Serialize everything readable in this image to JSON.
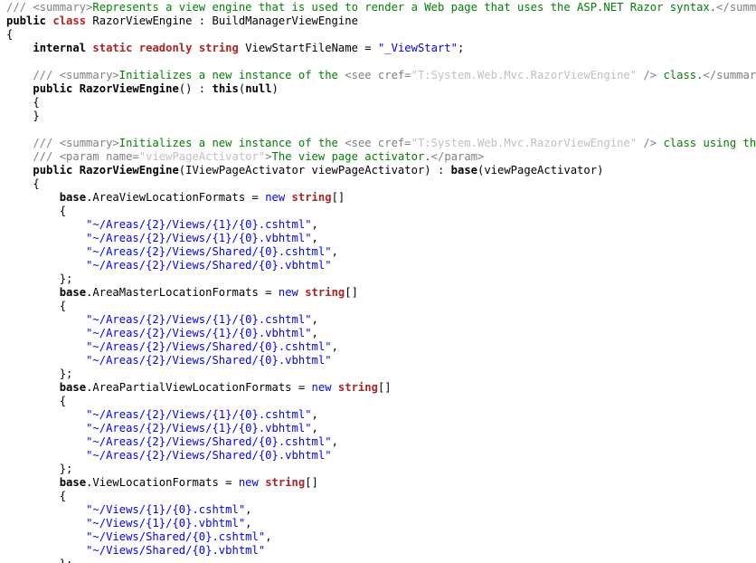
{
  "editor": {
    "lines": [
      [
        {
          "t": "/// ",
          "s": "dc"
        },
        {
          "t": "<summary>",
          "s": "dc"
        },
        {
          "t": "Represents a view engine that is used to render a Web page that uses the ASP.NET Razor syntax.",
          "s": "cm"
        },
        {
          "t": "</summary>",
          "s": "dc"
        }
      ],
      [
        {
          "t": "public ",
          "s": "kwb"
        },
        {
          "t": "class ",
          "s": "kwbr"
        },
        {
          "t": "RazorViewEngine : BuildManagerViewEngine",
          "s": "plain"
        }
      ],
      [
        {
          "t": "{",
          "s": "plain"
        }
      ],
      [
        {
          "t": "    ",
          "s": "plain"
        },
        {
          "t": "internal ",
          "s": "kwb"
        },
        {
          "t": "static readonly ",
          "s": "kwbr"
        },
        {
          "t": "string ",
          "s": "kwbr"
        },
        {
          "t": "ViewStartFileName = ",
          "s": "plain"
        },
        {
          "t": "\"_ViewStart\"",
          "s": "str"
        },
        {
          "t": ";",
          "s": "plain"
        }
      ],
      [
        {
          "t": "",
          "s": "plain"
        }
      ],
      [
        {
          "t": "    /// ",
          "s": "dc"
        },
        {
          "t": "<summary>",
          "s": "dc"
        },
        {
          "t": "Initializes a new instance of the ",
          "s": "cm"
        },
        {
          "t": "<see cref=",
          "s": "dc"
        },
        {
          "t": "\"T:System.Web.Mvc.RazorViewEngine\"",
          "s": "da"
        },
        {
          "t": " />",
          "s": "dc"
        },
        {
          "t": " class.",
          "s": "cm"
        },
        {
          "t": "</summary>",
          "s": "dc"
        }
      ],
      [
        {
          "t": "    ",
          "s": "plain"
        },
        {
          "t": "public ",
          "s": "kwb"
        },
        {
          "t": "RazorViewEngine",
          "s": "kwb"
        },
        {
          "t": "() : ",
          "s": "plain"
        },
        {
          "t": "this",
          "s": "kwb"
        },
        {
          "t": "(",
          "s": "plain"
        },
        {
          "t": "null",
          "s": "kwb"
        },
        {
          "t": ")",
          "s": "plain"
        }
      ],
      [
        {
          "t": "    {",
          "s": "plain"
        }
      ],
      [
        {
          "t": "    }",
          "s": "plain"
        }
      ],
      [
        {
          "t": "",
          "s": "plain"
        }
      ],
      [
        {
          "t": "    /// ",
          "s": "dc"
        },
        {
          "t": "<summary>",
          "s": "dc"
        },
        {
          "t": "Initializes a new instance of the ",
          "s": "cm"
        },
        {
          "t": "<see cref=",
          "s": "dc"
        },
        {
          "t": "\"T:System.Web.Mvc.RazorViewEngine\"",
          "s": "da"
        },
        {
          "t": " />",
          "s": "dc"
        },
        {
          "t": " class using the view",
          "s": "cm"
        }
      ],
      [
        {
          "t": "    /// ",
          "s": "dc"
        },
        {
          "t": "<param name=",
          "s": "dc"
        },
        {
          "t": "\"viewPageActivator\"",
          "s": "da"
        },
        {
          "t": ">",
          "s": "dc"
        },
        {
          "t": "The view page activator.",
          "s": "cm"
        },
        {
          "t": "</param>",
          "s": "dc"
        }
      ],
      [
        {
          "t": "    ",
          "s": "plain"
        },
        {
          "t": "public ",
          "s": "kwb"
        },
        {
          "t": "RazorViewEngine",
          "s": "kwb"
        },
        {
          "t": "(IViewPageActivator viewPageActivator) : ",
          "s": "plain"
        },
        {
          "t": "base",
          "s": "kwb"
        },
        {
          "t": "(viewPageActivator)",
          "s": "plain"
        }
      ],
      [
        {
          "t": "    {",
          "s": "plain"
        }
      ],
      [
        {
          "t": "        ",
          "s": "plain"
        },
        {
          "t": "base",
          "s": "kwb"
        },
        {
          "t": ".AreaViewLocationFormats = ",
          "s": "plain"
        },
        {
          "t": "new ",
          "s": "kw"
        },
        {
          "t": "string",
          "s": "kwbr"
        },
        {
          "t": "[]",
          "s": "plain"
        }
      ],
      [
        {
          "t": "        {",
          "s": "plain"
        }
      ],
      [
        {
          "t": "            ",
          "s": "plain"
        },
        {
          "t": "\"~/Areas/{2}/Views/{1}/{0}.cshtml\"",
          "s": "str"
        },
        {
          "t": ",",
          "s": "plain"
        }
      ],
      [
        {
          "t": "            ",
          "s": "plain"
        },
        {
          "t": "\"~/Areas/{2}/Views/{1}/{0}.vbhtml\"",
          "s": "str"
        },
        {
          "t": ",",
          "s": "plain"
        }
      ],
      [
        {
          "t": "            ",
          "s": "plain"
        },
        {
          "t": "\"~/Areas/{2}/Views/Shared/{0}.cshtml\"",
          "s": "str"
        },
        {
          "t": ",",
          "s": "plain"
        }
      ],
      [
        {
          "t": "            ",
          "s": "plain"
        },
        {
          "t": "\"~/Areas/{2}/Views/Shared/{0}.vbhtml\"",
          "s": "str"
        }
      ],
      [
        {
          "t": "        };",
          "s": "plain"
        }
      ],
      [
        {
          "t": "        ",
          "s": "plain"
        },
        {
          "t": "base",
          "s": "kwb"
        },
        {
          "t": ".AreaMasterLocationFormats = ",
          "s": "plain"
        },
        {
          "t": "new ",
          "s": "kw"
        },
        {
          "t": "string",
          "s": "kwbr"
        },
        {
          "t": "[]",
          "s": "plain"
        }
      ],
      [
        {
          "t": "        {",
          "s": "plain"
        }
      ],
      [
        {
          "t": "            ",
          "s": "plain"
        },
        {
          "t": "\"~/Areas/{2}/Views/{1}/{0}.cshtml\"",
          "s": "str"
        },
        {
          "t": ",",
          "s": "plain"
        }
      ],
      [
        {
          "t": "            ",
          "s": "plain"
        },
        {
          "t": "\"~/Areas/{2}/Views/{1}/{0}.vbhtml\"",
          "s": "str"
        },
        {
          "t": ",",
          "s": "plain"
        }
      ],
      [
        {
          "t": "            ",
          "s": "plain"
        },
        {
          "t": "\"~/Areas/{2}/Views/Shared/{0}.cshtml\"",
          "s": "str"
        },
        {
          "t": ",",
          "s": "plain"
        }
      ],
      [
        {
          "t": "            ",
          "s": "plain"
        },
        {
          "t": "\"~/Areas/{2}/Views/Shared/{0}.vbhtml\"",
          "s": "str"
        }
      ],
      [
        {
          "t": "        };",
          "s": "plain"
        }
      ],
      [
        {
          "t": "        ",
          "s": "plain"
        },
        {
          "t": "base",
          "s": "kwb"
        },
        {
          "t": ".AreaPartialViewLocationFormats = ",
          "s": "plain"
        },
        {
          "t": "new ",
          "s": "kw"
        },
        {
          "t": "string",
          "s": "kwbr"
        },
        {
          "t": "[]",
          "s": "plain"
        }
      ],
      [
        {
          "t": "        {",
          "s": "plain"
        }
      ],
      [
        {
          "t": "            ",
          "s": "plain"
        },
        {
          "t": "\"~/Areas/{2}/Views/{1}/{0}.cshtml\"",
          "s": "str"
        },
        {
          "t": ",",
          "s": "plain"
        }
      ],
      [
        {
          "t": "            ",
          "s": "plain"
        },
        {
          "t": "\"~/Areas/{2}/Views/{1}/{0}.vbhtml\"",
          "s": "str"
        },
        {
          "t": ",",
          "s": "plain"
        }
      ],
      [
        {
          "t": "            ",
          "s": "plain"
        },
        {
          "t": "\"~/Areas/{2}/Views/Shared/{0}.cshtml\"",
          "s": "str"
        },
        {
          "t": ",",
          "s": "plain"
        }
      ],
      [
        {
          "t": "            ",
          "s": "plain"
        },
        {
          "t": "\"~/Areas/{2}/Views/Shared/{0}.vbhtml\"",
          "s": "str"
        }
      ],
      [
        {
          "t": "        };",
          "s": "plain"
        }
      ],
      [
        {
          "t": "        ",
          "s": "plain"
        },
        {
          "t": "base",
          "s": "kwb"
        },
        {
          "t": ".ViewLocationFormats = ",
          "s": "plain"
        },
        {
          "t": "new ",
          "s": "kw"
        },
        {
          "t": "string",
          "s": "kwbr"
        },
        {
          "t": "[]",
          "s": "plain"
        }
      ],
      [
        {
          "t": "        {",
          "s": "plain"
        }
      ],
      [
        {
          "t": "            ",
          "s": "plain"
        },
        {
          "t": "\"~/Views/{1}/{0}.cshtml\"",
          "s": "str"
        },
        {
          "t": ",",
          "s": "plain"
        }
      ],
      [
        {
          "t": "            ",
          "s": "plain"
        },
        {
          "t": "\"~/Views/{1}/{0}.vbhtml\"",
          "s": "str"
        },
        {
          "t": ",",
          "s": "plain"
        }
      ],
      [
        {
          "t": "            ",
          "s": "plain"
        },
        {
          "t": "\"~/Views/Shared/{0}.cshtml\"",
          "s": "str"
        },
        {
          "t": ",",
          "s": "plain"
        }
      ],
      [
        {
          "t": "            ",
          "s": "plain"
        },
        {
          "t": "\"~/Views/Shared/{0}.vbhtml\"",
          "s": "str"
        }
      ],
      [
        {
          "t": "        };",
          "s": "plain"
        }
      ]
    ]
  }
}
